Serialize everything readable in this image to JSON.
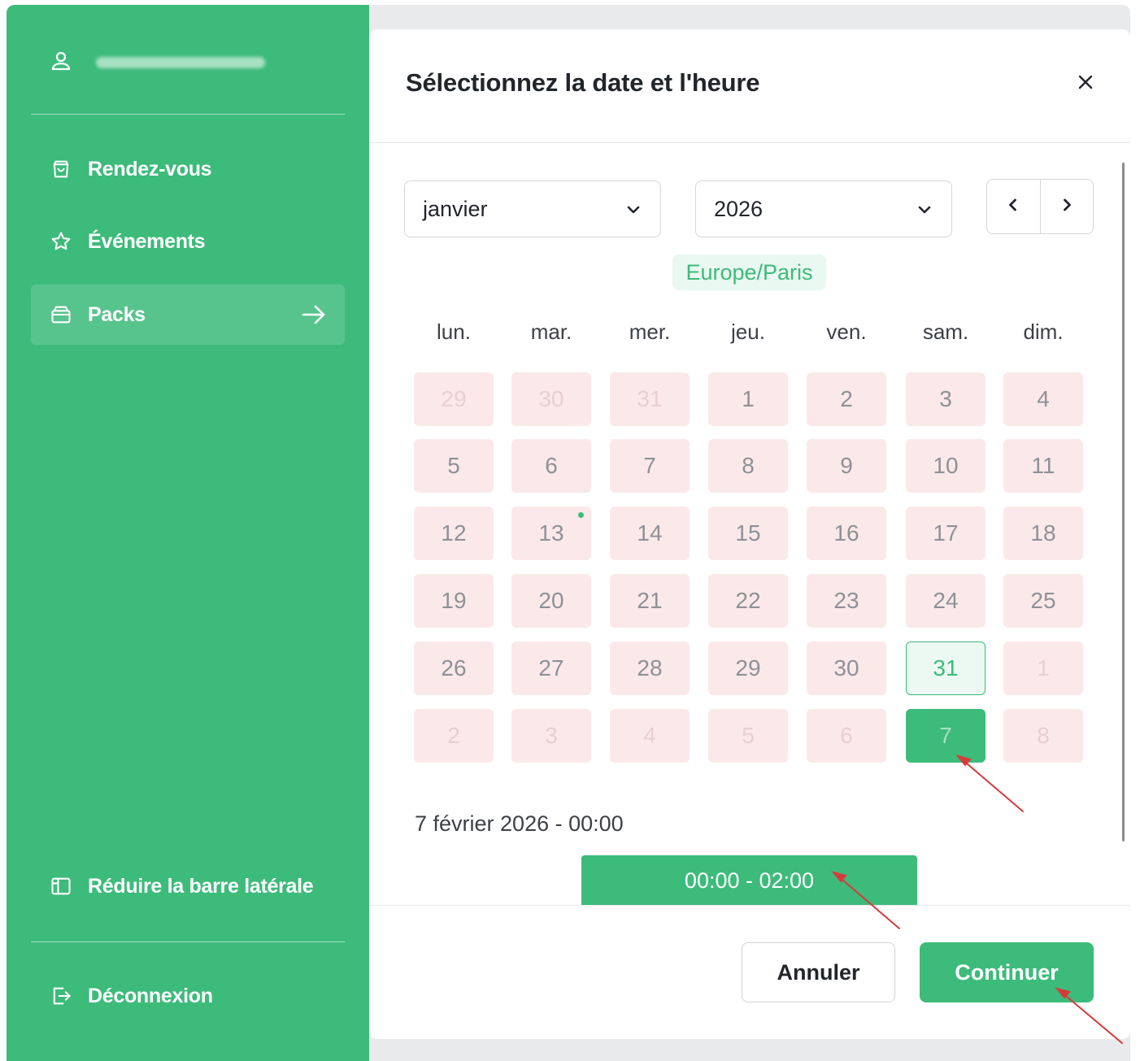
{
  "sidebar": {
    "user": {
      "name": "testsuser",
      "icon": "user-icon"
    },
    "items": [
      {
        "label": "Rendez-vous",
        "icon": "shopping-bag-icon"
      },
      {
        "label": "Événements",
        "icon": "star-icon"
      },
      {
        "label": "Packs",
        "icon": "package-icon",
        "active": true
      }
    ],
    "collapse_label": "Réduire la barre latérale",
    "logout_label": "Déconnexion"
  },
  "modal": {
    "title": "Sélectionnez la date et l'heure",
    "month": "janvier",
    "year": "2026",
    "timezone": "Europe/Paris",
    "weekdays": [
      "lun.",
      "mar.",
      "mer.",
      "jeu.",
      "ven.",
      "sam.",
      "dim."
    ],
    "weeks": [
      [
        "29",
        "30",
        "31",
        "1",
        "2",
        "3",
        "4"
      ],
      [
        "5",
        "6",
        "7",
        "8",
        "9",
        "10",
        "11"
      ],
      [
        "12",
        "13",
        "14",
        "15",
        "16",
        "17",
        "18"
      ],
      [
        "19",
        "20",
        "21",
        "22",
        "23",
        "24",
        "25"
      ],
      [
        "26",
        "27",
        "28",
        "29",
        "30",
        "31",
        "1"
      ],
      [
        "2",
        "3",
        "4",
        "5",
        "6",
        "7",
        "8"
      ]
    ],
    "selected_summary": "7 février 2026 - 00:00",
    "time_slot": "00:00 - 02:00",
    "cancel_label": "Annuler",
    "continue_label": "Continuer"
  },
  "colors": {
    "brand_green": "#3dbb7b",
    "unavailable_day_bg": "#fbe9e9",
    "annotation_arrow": "#d63a3a"
  }
}
